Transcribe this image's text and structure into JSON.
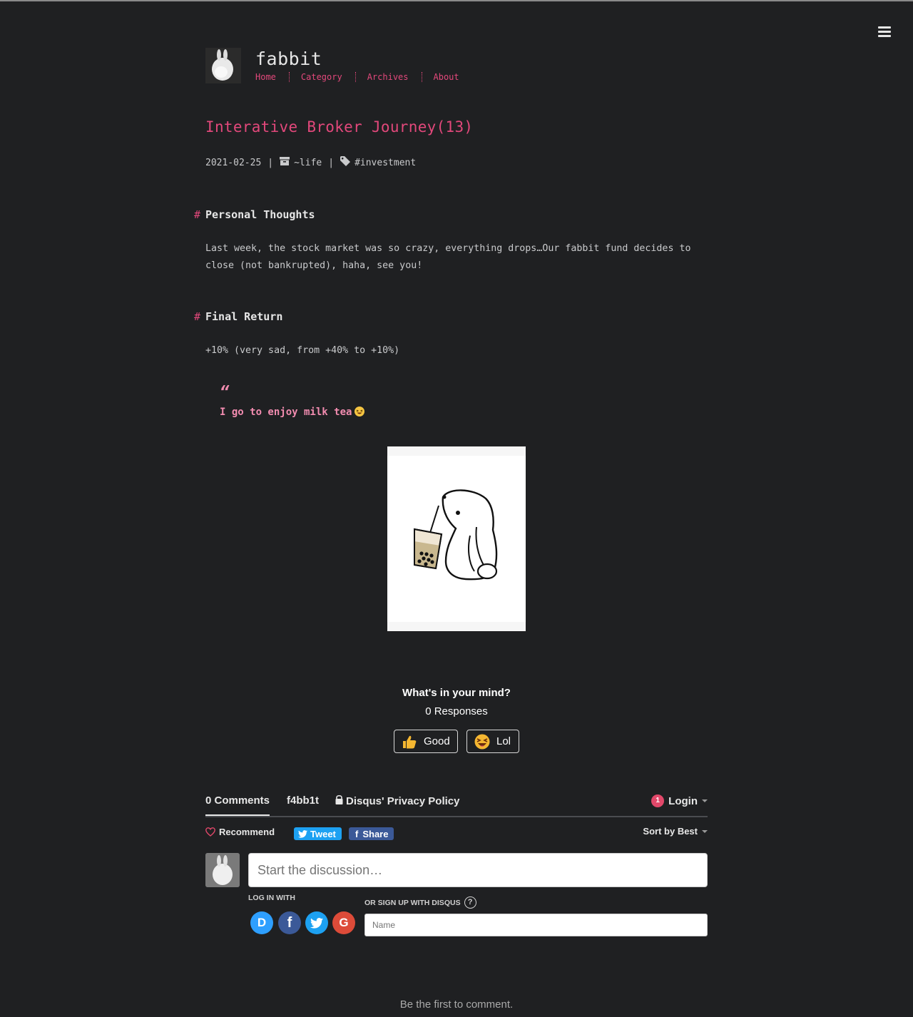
{
  "site": {
    "title": "fabbit",
    "nav": [
      "Home",
      "Category",
      "Archives",
      "About"
    ]
  },
  "post": {
    "title": "Interative Broker Journey(13)",
    "date": "2021-02-25",
    "category": "~life",
    "tag": "#investment",
    "sections": [
      {
        "heading": "Personal Thoughts",
        "body": "Last week, the stock market was so crazy, everything drops…Our fabbit fund decides to close (not bankrupted), haha, see you!"
      },
      {
        "heading": "Final Return",
        "body": "+10% (very sad, from +40% to +10%)"
      }
    ],
    "quote_mark": "“",
    "quote": "I go to enjoy milk tea"
  },
  "reactions": {
    "title": "What's in your mind?",
    "responses": "0 Responses",
    "buttons": [
      "Good",
      "Lol"
    ]
  },
  "disqus": {
    "comments_tab": "0 Comments",
    "community_tab": "f4bb1t",
    "privacy": "Disqus' Privacy Policy",
    "login": "Login",
    "login_badge": "1",
    "recommend": "Recommend",
    "tweet": "Tweet",
    "share": "Share",
    "sort": "Sort by Best",
    "placeholder": "Start the discussion…",
    "login_with": "LOG IN WITH",
    "signup_with": "OR SIGN UP WITH DISQUS",
    "help": "?",
    "name_placeholder": "Name",
    "providers": [
      "D",
      "f",
      "t",
      "G"
    ],
    "provider_colors": [
      "#2e9fff",
      "#3b5998",
      "#1da1f2",
      "#dd4b39"
    ],
    "empty": "Be the first to comment."
  },
  "colors": {
    "background": "#1f2022",
    "accent": "#e2487b",
    "quote": "#f28cb0"
  }
}
